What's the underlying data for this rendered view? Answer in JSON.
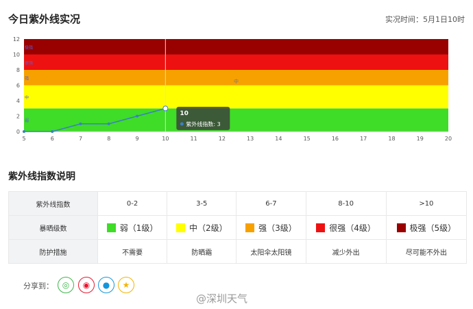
{
  "header": {
    "title": "今日紫外线实况",
    "observed": "实况时间：5月1日10时"
  },
  "chart_data": {
    "type": "line",
    "x": [
      5,
      6,
      7,
      8,
      9,
      10
    ],
    "series": [
      {
        "name": "紫外线指数",
        "values": [
          0,
          0,
          1,
          1,
          2,
          3
        ]
      }
    ],
    "xlim": [
      5,
      20
    ],
    "ylim": [
      0,
      12
    ],
    "x_ticks": [
      5,
      6,
      7,
      8,
      9,
      10,
      11,
      12,
      13,
      14,
      15,
      16,
      17,
      18,
      19,
      20
    ],
    "y_ticks": [
      0,
      2,
      4,
      6,
      8,
      10,
      12
    ],
    "bands": [
      {
        "from": 0,
        "to": 3,
        "color": "#3fdc28",
        "label": "弱"
      },
      {
        "from": 3,
        "to": 6,
        "color": "#ffff00",
        "label": "中"
      },
      {
        "from": 6,
        "to": 8,
        "color": "#f7a100",
        "label": "强"
      },
      {
        "from": 8,
        "to": 10,
        "color": "#ee1111",
        "label": "很强"
      },
      {
        "from": 10,
        "to": 12,
        "color": "#990000",
        "label": "极强"
      }
    ],
    "mid_label": "中",
    "tooltip": {
      "x": 10,
      "title": "10",
      "text": "紫外线指数: 3"
    },
    "line_color": "#3a7fc4"
  },
  "legend_section": {
    "title": "紫外线指数说明",
    "row1": {
      "head": "紫外线指数",
      "cells": [
        "0-2",
        "3-5",
        "6-7",
        "8-10",
        ">10"
      ]
    },
    "row2": {
      "head": "暴晒级数",
      "cells": [
        {
          "label": "弱（1级）",
          "color": "#3fdc28"
        },
        {
          "label": "中（2级）",
          "color": "#ffff00"
        },
        {
          "label": "强（3级）",
          "color": "#f7a100"
        },
        {
          "label": "很强（4级）",
          "color": "#ee1111"
        },
        {
          "label": "极强（5级）",
          "color": "#990000"
        }
      ]
    },
    "row3": {
      "head": "防护措施",
      "cells": [
        "不需要",
        "防晒霜",
        "太阳伞太阳镜",
        "减少外出",
        "尽可能不外出"
      ]
    }
  },
  "share": {
    "label": "分享到：",
    "icons": [
      {
        "name": "wechat-icon",
        "glyph": "◎",
        "color": "#3bb54a"
      },
      {
        "name": "weibo-icon",
        "glyph": "◉",
        "color": "#e6162d"
      },
      {
        "name": "qq-icon",
        "glyph": "●",
        "color": "#1296db"
      },
      {
        "name": "qzone-icon",
        "glyph": "★",
        "color": "#f4b400"
      }
    ]
  },
  "watermark": "@深圳天气"
}
